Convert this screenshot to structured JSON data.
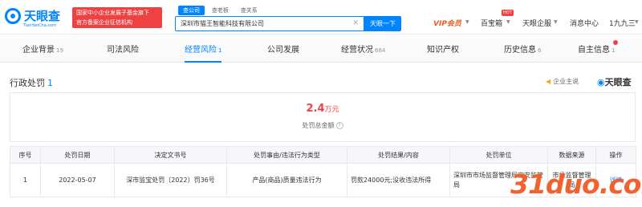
{
  "header": {
    "logo_text": "天眼查",
    "logo_sub": "TianYanCha.com",
    "badge_line1": "国家中小企业发展子基金旗下",
    "badge_line2": "官方备案企业征信机构",
    "search_tabs": [
      "查公司",
      "查老板",
      "查关系"
    ],
    "search_value": "深圳市猫王智能科技有限公司",
    "search_button": "天眼一下",
    "vip_label": "VIP会员",
    "baibao_label": "百宝箱",
    "hot_label": "HOT",
    "enterprise_label": "天眼企服",
    "message_label": "消息中心",
    "user_label": "1九九三"
  },
  "tabs": [
    {
      "label": "企业背景",
      "count": "19"
    },
    {
      "label": "司法风险",
      "count": ""
    },
    {
      "label": "经营风险",
      "count": "1"
    },
    {
      "label": "公司发展",
      "count": ""
    },
    {
      "label": "经营状况",
      "count": "684"
    },
    {
      "label": "知识产权",
      "count": ""
    },
    {
      "label": "历史信息",
      "count": "6"
    },
    {
      "label": "自主信息",
      "count": "1"
    }
  ],
  "section": {
    "title": "行政处罚",
    "count": "1",
    "notice": "企业主说",
    "brand": "天眼查"
  },
  "summary": {
    "value": "2.4",
    "unit": "万元",
    "label": "处罚总金额",
    "help": "?"
  },
  "table": {
    "headers": [
      "序号",
      "处罚日期",
      "决定文书号",
      "处罚事由/违法行为类型",
      "处罚结果/内容",
      "处罚单位",
      "数据来源",
      "操作"
    ],
    "rows": [
      [
        "1",
        "2022-05-07",
        "深市监宝处罚〔2022〕罚36号",
        "产品(商品)质量违法行为",
        "罚款24000元;没收违法所得",
        "深圳市市场监督管理局宝安监管局",
        "市场监督管理局",
        "详情"
      ]
    ]
  },
  "watermark": "31duo.com",
  "colors": {
    "accent": "#0084ff",
    "danger": "#f04142",
    "vip": "#f25a1f"
  }
}
